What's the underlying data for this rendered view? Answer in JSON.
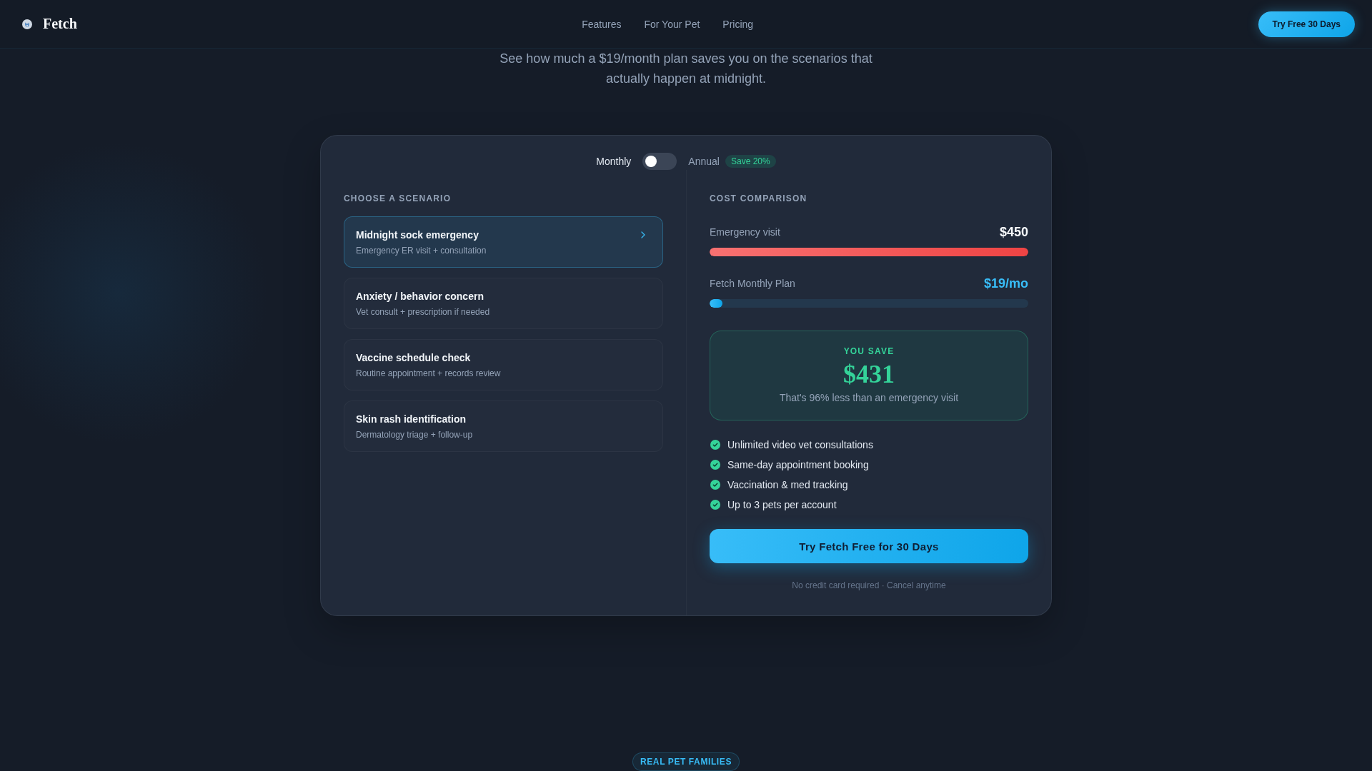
{
  "nav": {
    "brand": "Fetch",
    "links": [
      {
        "label": "Features"
      },
      {
        "label": "For Your Pet"
      },
      {
        "label": "Pricing"
      }
    ],
    "cta": "Try Free 30 Days"
  },
  "hero": {
    "subtitle": "See how much a $19/month plan saves you on the scenarios that actually happen at midnight."
  },
  "pricing": {
    "billing": {
      "monthly_label": "Monthly",
      "annual_label": "Annual",
      "annual": false,
      "badge": "Save 20%"
    },
    "scenarios_heading": "CHOOSE A SCENARIO",
    "scenarios": [
      {
        "title": "Midnight sock emergency",
        "detail": "Emergency ER visit + consultation",
        "selected": true
      },
      {
        "title": "Anxiety / behavior concern",
        "detail": "Vet consult + prescription if needed",
        "selected": false
      },
      {
        "title": "Vaccine schedule check",
        "detail": "Routine appointment + records review",
        "selected": false
      },
      {
        "title": "Skin rash identification",
        "detail": "Dermatology triage + follow-up",
        "selected": false
      }
    ],
    "comparison_heading": "COST COMPARISON",
    "costs": [
      {
        "kind": "emergency",
        "label": "Emergency visit",
        "amount": "$450",
        "level": 1
      },
      {
        "kind": "plan",
        "label": "Fetch Monthly Plan",
        "amount": "$19/mo",
        "level": 0.04
      }
    ],
    "savings": {
      "label": "YOU SAVE",
      "amount": "$431",
      "note": "That's 96% less than an emergency visit"
    },
    "features": [
      "Unlimited video vet consultations",
      "Same-day appointment booking",
      "Vaccination & med tracking",
      "Up to 3 pets per account"
    ],
    "cta": "Try Fetch Free for 30 Days",
    "fine_print": "No credit card required · Cancel anytime"
  },
  "next_section": {
    "badge": "REAL PET FAMILIES"
  }
}
